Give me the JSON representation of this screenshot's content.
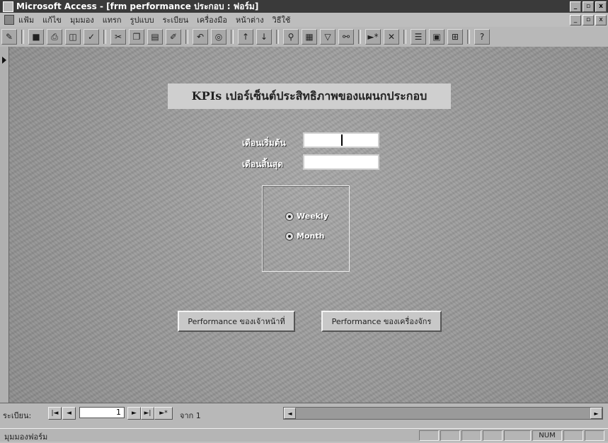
{
  "window": {
    "title": "Microsoft Access - [frm performance ประกอบ : ฟอร์ม]",
    "controls": [
      "_",
      "▫",
      "x"
    ]
  },
  "menubar": {
    "items": [
      "แฟ้ม",
      "แก้ไข",
      "มุมมอง",
      "แทรก",
      "รูปแบบ",
      "ระเบียน",
      "เครื่องมือ",
      "หน้าต่าง",
      "วิธีใช้"
    ]
  },
  "toolbar": {
    "icons": [
      "view-icon",
      "save-icon",
      "print-icon",
      "print-preview-icon",
      "spelling-icon",
      "cut-icon",
      "copy-icon",
      "paste-icon",
      "format-painter-icon",
      "undo-icon",
      "hyperlink-icon",
      "sort-ascending-icon",
      "sort-descending-icon",
      "filter-by-selection-icon",
      "filter-by-form-icon",
      "apply-filter-icon",
      "find-icon",
      "new-record-icon",
      "delete-record-icon",
      "properties-icon",
      "database-window-icon",
      "new-object-icon",
      "help-icon"
    ]
  },
  "form": {
    "header": "KPIs เปอร์เซ็นต์ประสิทธิภาพของแผนกประกอบ",
    "start_month_label": "เดือนเริ่มต้น",
    "end_month_label": "เดือนสิ้นสุด",
    "start_month_value": "",
    "end_month_value": "",
    "options": [
      {
        "label": "Weekly",
        "selected": true
      },
      {
        "label": "Month",
        "selected": true
      }
    ],
    "button_staff": "Performance ของเจ้าหน้าที่",
    "button_machine": "Performance ของเครื่องจักร"
  },
  "navigation": {
    "label": "ระเบียน:",
    "current_record": "1",
    "of_label": "จาก 1",
    "first": "|◄",
    "prev": "◄",
    "next": "►",
    "last": "►|",
    "new": "►*"
  },
  "status": {
    "text": "มุมมองฟอร์ม",
    "num": "NUM"
  }
}
